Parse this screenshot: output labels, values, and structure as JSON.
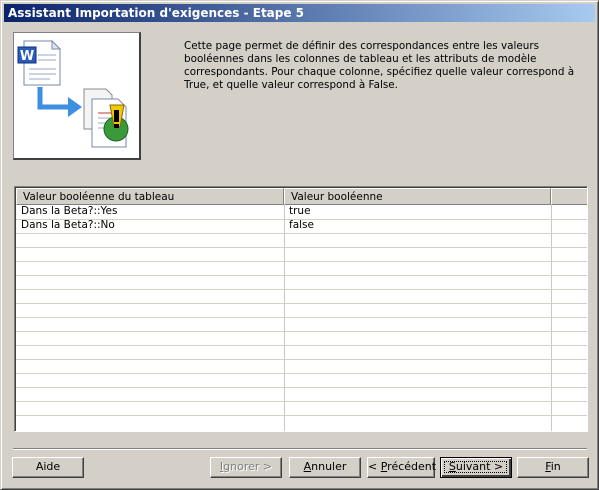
{
  "window": {
    "title": "Assistant Importation d'exigences - Etape 5"
  },
  "description": "Cette page permet de définir des correspondances entre les valeurs\nbooléennes dans les colonnes de tableau et les attributs de modèle\ncorrespondants. Pour chaque colonne, spécifiez quelle valeur correspond à\nTrue, et quelle valeur correspond à False.",
  "table": {
    "columns": [
      "Valeur booléenne du tableau",
      "Valeur booléenne",
      ""
    ],
    "rows": [
      {
        "source": "Dans la Beta?::Yes",
        "value": "true"
      },
      {
        "source": "Dans la Beta?::No",
        "value": "false"
      }
    ]
  },
  "buttons": {
    "help": "Aide",
    "ignore_pre": "",
    "ignore_mn": "I",
    "ignore_post": "gnorer >",
    "cancel_pre": "",
    "cancel_mn": "A",
    "cancel_post": "nnuler",
    "prev_pre": "< ",
    "prev_mn": "P",
    "prev_post": "récédent",
    "next_pre": "",
    "next_mn": "S",
    "next_post": "uivant >",
    "finish_pre": "",
    "finish_mn": "F",
    "finish_post": "in"
  },
  "icons": {
    "wizard_image": "word-document-import-icon"
  },
  "colors": {
    "title_start": "#0a246a",
    "title_end": "#a6caf0",
    "face": "#d4d0c8"
  }
}
